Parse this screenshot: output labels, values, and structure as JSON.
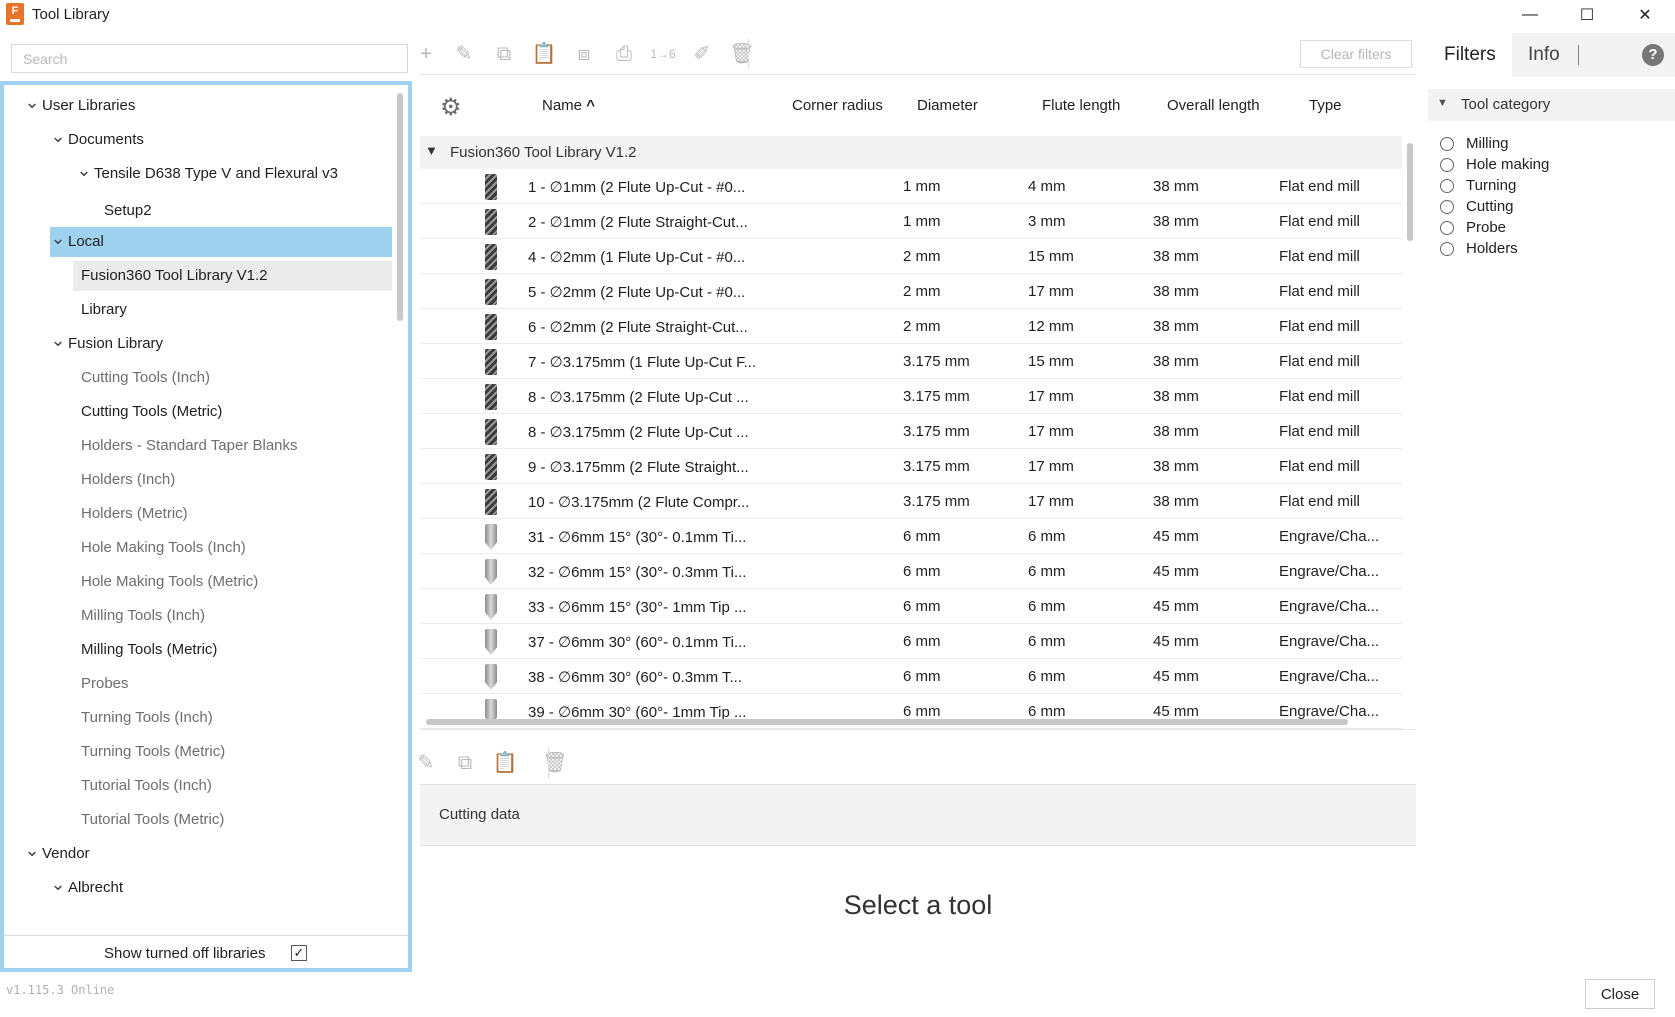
{
  "window": {
    "title": "Tool Library",
    "minimize": "—",
    "maximize": "☐",
    "close": "✕"
  },
  "left": {
    "search_placeholder": "Search",
    "tree": [
      {
        "label": "User Libraries",
        "level": 0,
        "chevron": true,
        "state": "normal"
      },
      {
        "label": "Documents",
        "level": 1,
        "chevron": true,
        "state": "normal"
      },
      {
        "label": "Tensile D638 Type V and Flexural v3",
        "level": 2,
        "chevron": true,
        "state": "normal"
      },
      {
        "label": "Setup2",
        "level": 3,
        "chevron": false,
        "state": "normal"
      },
      {
        "label": "Local",
        "level": 1,
        "chevron": true,
        "state": "selected"
      },
      {
        "label": "Fusion360 Tool Library V1.2",
        "level": 2,
        "chevron": false,
        "state": "hover"
      },
      {
        "label": "Library",
        "level": 2,
        "chevron": false,
        "state": "normal"
      },
      {
        "label": "Fusion Library",
        "level": 1,
        "chevron": true,
        "state": "normal"
      },
      {
        "label": "Cutting Tools (Inch)",
        "level": 2,
        "chevron": false,
        "state": "dim"
      },
      {
        "label": "Cutting Tools (Metric)",
        "level": 2,
        "chevron": false,
        "state": "normal"
      },
      {
        "label": "Holders - Standard Taper Blanks",
        "level": 2,
        "chevron": false,
        "state": "dim"
      },
      {
        "label": "Holders (Inch)",
        "level": 2,
        "chevron": false,
        "state": "dim"
      },
      {
        "label": "Holders (Metric)",
        "level": 2,
        "chevron": false,
        "state": "dim"
      },
      {
        "label": "Hole Making Tools (Inch)",
        "level": 2,
        "chevron": false,
        "state": "dim"
      },
      {
        "label": "Hole Making Tools (Metric)",
        "level": 2,
        "chevron": false,
        "state": "dim"
      },
      {
        "label": "Milling Tools (Inch)",
        "level": 2,
        "chevron": false,
        "state": "dim"
      },
      {
        "label": "Milling Tools (Metric)",
        "level": 2,
        "chevron": false,
        "state": "normal"
      },
      {
        "label": "Probes",
        "level": 2,
        "chevron": false,
        "state": "dim"
      },
      {
        "label": "Turning Tools (Inch)",
        "level": 2,
        "chevron": false,
        "state": "dim"
      },
      {
        "label": "Turning Tools (Metric)",
        "level": 2,
        "chevron": false,
        "state": "dim"
      },
      {
        "label": "Tutorial Tools (Inch)",
        "level": 2,
        "chevron": false,
        "state": "dim"
      },
      {
        "label": "Tutorial Tools (Metric)",
        "level": 2,
        "chevron": false,
        "state": "dim"
      },
      {
        "label": "Vendor",
        "level": 0,
        "chevron": true,
        "state": "normal"
      },
      {
        "label": "Albrecht",
        "level": 1,
        "chevron": true,
        "state": "normal"
      }
    ],
    "show_turned_off_label": "Show turned off libraries",
    "show_turned_off_checked": true
  },
  "toolbar": {
    "icons": [
      {
        "name": "add-icon",
        "glyph": "+"
      },
      {
        "name": "edit-icon",
        "glyph": "✎"
      },
      {
        "name": "copy-icon",
        "glyph": "⧉"
      },
      {
        "name": "paste-icon",
        "glyph": "📋"
      },
      {
        "name": "duplicate-icon",
        "glyph": "⧈"
      },
      {
        "name": "print-icon",
        "glyph": "⎙"
      },
      {
        "name": "renumber-icon",
        "glyph": "1→6"
      },
      {
        "name": "brush-icon",
        "glyph": "✐"
      },
      {
        "name": "delete-icon",
        "glyph": "🗑"
      }
    ],
    "clear_filters": "Clear filters"
  },
  "table": {
    "columns": {
      "name": "Name",
      "corner_radius": "Corner radius",
      "diameter": "Diameter",
      "flute_length": "Flute length",
      "overall_length": "Overall length",
      "type": "Type"
    },
    "sort_indicator": "^",
    "group": "Fusion360 Tool Library V1.2",
    "rows": [
      {
        "name": "1 - ∅1mm (2 Flute Up-Cut - #0...",
        "diameter": "1 mm",
        "flute": "4 mm",
        "overall": "38 mm",
        "type": "Flat end mill",
        "icon": "mill"
      },
      {
        "name": "2 - ∅1mm (2 Flute Straight-Cut...",
        "diameter": "1 mm",
        "flute": "3 mm",
        "overall": "38 mm",
        "type": "Flat end mill",
        "icon": "mill"
      },
      {
        "name": "4 - ∅2mm (1 Flute Up-Cut - #0...",
        "diameter": "2 mm",
        "flute": "15 mm",
        "overall": "38 mm",
        "type": "Flat end mill",
        "icon": "mill"
      },
      {
        "name": "5 - ∅2mm (2 Flute Up-Cut - #0...",
        "diameter": "2 mm",
        "flute": "17 mm",
        "overall": "38 mm",
        "type": "Flat end mill",
        "icon": "mill"
      },
      {
        "name": "6 - ∅2mm (2 Flute Straight-Cut...",
        "diameter": "2 mm",
        "flute": "12 mm",
        "overall": "38 mm",
        "type": "Flat end mill",
        "icon": "mill"
      },
      {
        "name": "7 - ∅3.175mm (1 Flute Up-Cut F...",
        "diameter": "3.175 mm",
        "flute": "15 mm",
        "overall": "38 mm",
        "type": "Flat end mill",
        "icon": "mill"
      },
      {
        "name": "8 - ∅3.175mm (2 Flute Up-Cut ...",
        "diameter": "3.175 mm",
        "flute": "17 mm",
        "overall": "38 mm",
        "type": "Flat end mill",
        "icon": "mill"
      },
      {
        "name": "8 - ∅3.175mm (2 Flute Up-Cut ...",
        "diameter": "3.175 mm",
        "flute": "17 mm",
        "overall": "38 mm",
        "type": "Flat end mill",
        "icon": "mill"
      },
      {
        "name": "9 - ∅3.175mm (2 Flute Straight...",
        "diameter": "3.175 mm",
        "flute": "17 mm",
        "overall": "38 mm",
        "type": "Flat end mill",
        "icon": "mill"
      },
      {
        "name": "10 - ∅3.175mm (2 Flute Compr...",
        "diameter": "3.175 mm",
        "flute": "17 mm",
        "overall": "38 mm",
        "type": "Flat end mill",
        "icon": "mill"
      },
      {
        "name": "31 - ∅6mm 15° (30°- 0.1mm Ti...",
        "diameter": "6 mm",
        "flute": "6 mm",
        "overall": "45 mm",
        "type": "Engrave/Cha...",
        "icon": "engr"
      },
      {
        "name": "32 - ∅6mm 15° (30°- 0.3mm Ti...",
        "diameter": "6 mm",
        "flute": "6 mm",
        "overall": "45 mm",
        "type": "Engrave/Cha...",
        "icon": "engr"
      },
      {
        "name": "33 - ∅6mm 15° (30°- 1mm Tip ...",
        "diameter": "6 mm",
        "flute": "6 mm",
        "overall": "45 mm",
        "type": "Engrave/Cha...",
        "icon": "engr"
      },
      {
        "name": "37 - ∅6mm 30° (60°- 0.1mm Ti...",
        "diameter": "6 mm",
        "flute": "6 mm",
        "overall": "45 mm",
        "type": "Engrave/Cha...",
        "icon": "engr"
      },
      {
        "name": "38 - ∅6mm 30° (60°- 0.3mm T...",
        "diameter": "6 mm",
        "flute": "6 mm",
        "overall": "45 mm",
        "type": "Engrave/Cha...",
        "icon": "engr"
      },
      {
        "name": "39 - ∅6mm 30° (60°- 1mm Tip ...",
        "diameter": "6 mm",
        "flute": "6 mm",
        "overall": "45 mm",
        "type": "Engrave/Cha...",
        "icon": "engr"
      }
    ]
  },
  "bottom": {
    "icons": [
      {
        "name": "edit-icon",
        "glyph": "✎"
      },
      {
        "name": "copy-icon",
        "glyph": "⧉"
      },
      {
        "name": "paste-icon",
        "glyph": "📋"
      },
      {
        "name": "delete-icon",
        "glyph": "🗑"
      }
    ],
    "cutting_data": "Cutting data",
    "empty_message": "Select a tool"
  },
  "right": {
    "tabs": [
      {
        "label": "Filters",
        "active": true
      },
      {
        "label": "Info",
        "active": false
      }
    ],
    "help": "?",
    "category_title": "Tool category",
    "categories": [
      "Milling",
      "Hole making",
      "Turning",
      "Cutting",
      "Probe",
      "Holders"
    ]
  },
  "footer": {
    "version": "v1.115.3 Online",
    "close_button": "Close"
  }
}
